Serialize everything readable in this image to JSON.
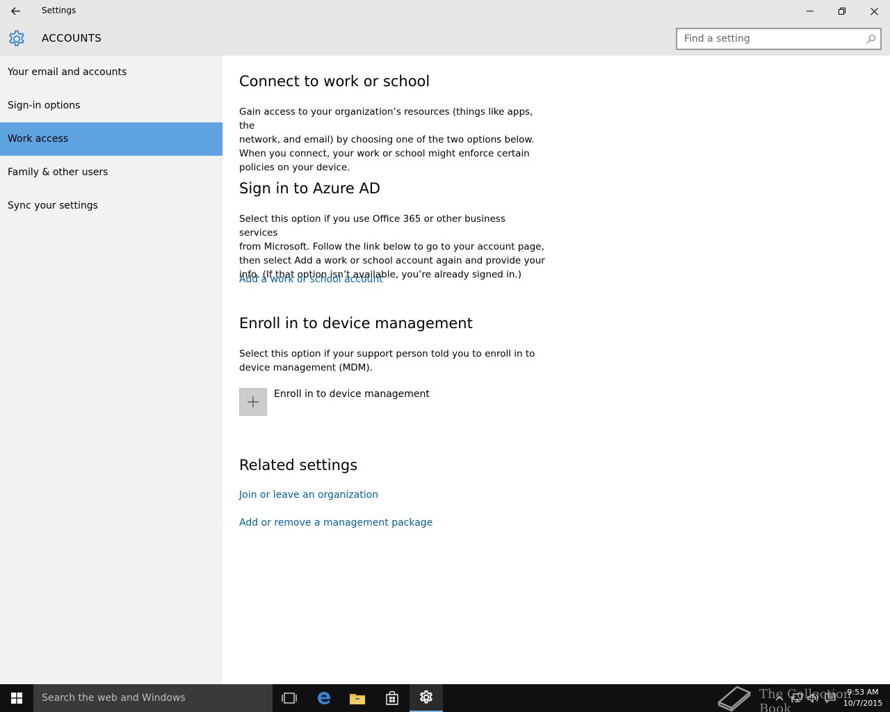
{
  "window": {
    "title": "Settings"
  },
  "header": {
    "section": "ACCOUNTS",
    "search_placeholder": "Find a setting"
  },
  "sidebar": {
    "items": [
      {
        "label": "Your email and accounts",
        "selected": false
      },
      {
        "label": "Sign-in options",
        "selected": false
      },
      {
        "label": "Work access",
        "selected": true
      },
      {
        "label": "Family & other users",
        "selected": false
      },
      {
        "label": "Sync your settings",
        "selected": false
      }
    ]
  },
  "content": {
    "connect": {
      "heading": "Connect to work or school",
      "lines": [
        "Gain access to your organization’s resources (things like apps, the",
        "network, and email) by choosing one of the two options below.",
        "When you connect, your work or school might enforce certain",
        "policies on your device."
      ]
    },
    "azure": {
      "heading": "Sign in to Azure AD",
      "lines": [
        "Select this option if you use Office 365 or other business services",
        "from Microsoft. Follow the link below to go to your account page,",
        "then select Add a work or school account again and provide your",
        "info. (If that option isn’t available, you’re already signed in.)"
      ],
      "link": "Add a work or school account"
    },
    "enroll": {
      "heading": "Enroll in to device management",
      "lines": [
        "Select this option if your support person told you to enroll in to",
        "device management (MDM)."
      ],
      "button_label": "Enroll in to device management"
    },
    "related": {
      "heading": "Related settings",
      "links": [
        "Join or leave an organization",
        "Add or remove a management package"
      ]
    }
  },
  "taskbar": {
    "search_placeholder": "Search the web and Windows",
    "clock_time": "9:53 AM",
    "clock_date": "10/7/2015",
    "watermark": "The Collection Book"
  },
  "colors": {
    "accent": "#5fa3e0",
    "link": "#0063b1",
    "sidebar_bg": "#f2f2f2",
    "titlebar_bg": "#e6e6e6",
    "taskbar_bg": "#101010"
  }
}
